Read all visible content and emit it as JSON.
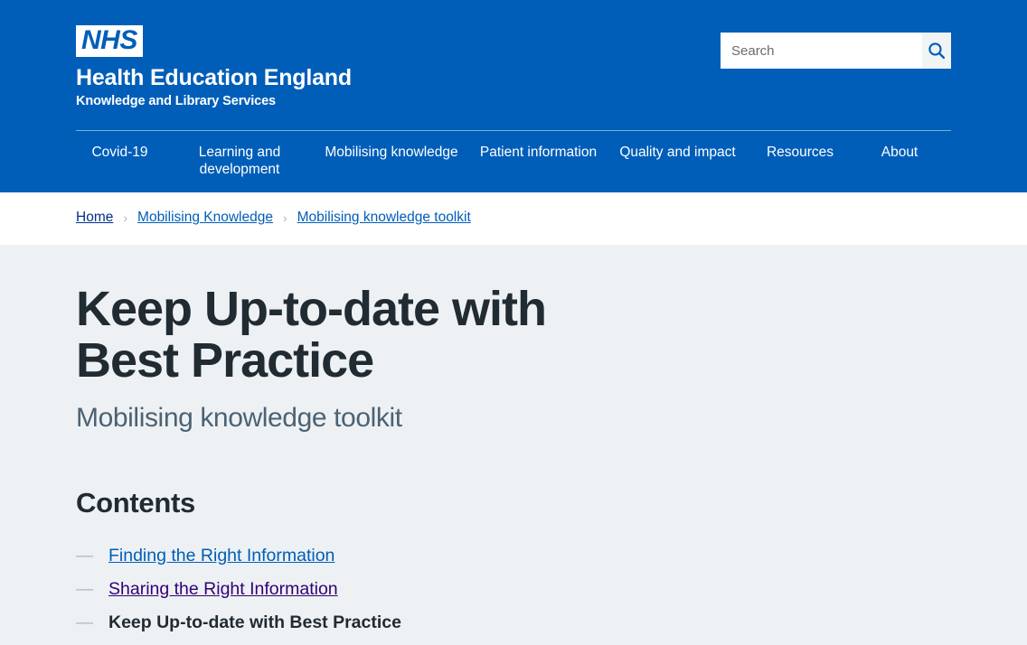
{
  "theme": {
    "nhs_blue": "#005eb8",
    "dark_navy": "#003087",
    "link_blue": "#005eb8",
    "visited_purple": "#330072",
    "body_text": "#212b32",
    "muted_slate": "#4c6272",
    "page_background": "#eef1f4",
    "breadcrumb_background": "#ffffff",
    "search_button_background": "#f0f4f5"
  },
  "header": {
    "logo_text": "NHS",
    "logo_icon_name": "nhs-logo",
    "brand_title": "Health Education England",
    "brand_subtitle": "Knowledge and Library Services",
    "search": {
      "placeholder": "Search",
      "value": "",
      "button_icon_name": "search-icon",
      "button_label": "Search"
    },
    "nav_items": [
      {
        "label": "Covid-19",
        "key": "covid"
      },
      {
        "label": "Learning and development",
        "key": "learning"
      },
      {
        "label": "Mobilising knowledge",
        "key": "mobilising"
      },
      {
        "label": "Patient information",
        "key": "patient"
      },
      {
        "label": "Quality and impact",
        "key": "quality"
      },
      {
        "label": "Resources",
        "key": "resources"
      },
      {
        "label": "About",
        "key": "about"
      }
    ]
  },
  "breadcrumb": {
    "separator": "›",
    "items": [
      {
        "label": "Home",
        "style": "home"
      },
      {
        "label": "Mobilising Knowledge",
        "style": "link"
      },
      {
        "label": "Mobilising knowledge toolkit",
        "style": "link"
      }
    ]
  },
  "main": {
    "title": "Keep Up-to-date with Best Practice",
    "subtitle": "Mobilising knowledge toolkit",
    "contents_heading": "Contents",
    "contents_marker": "—",
    "contents_items": [
      {
        "label": "Finding the Right Information",
        "state": "unvisited"
      },
      {
        "label": "Sharing the Right Information",
        "state": "visited"
      },
      {
        "label": "Keep Up-to-date with Best Practice",
        "state": "current"
      }
    ]
  }
}
